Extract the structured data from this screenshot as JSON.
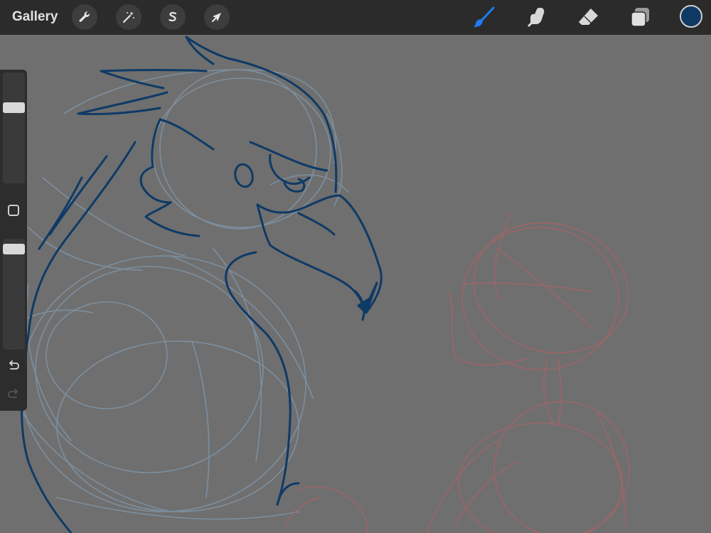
{
  "toolbar": {
    "gallery_label": "Gallery",
    "left_tools": [
      {
        "name": "actions",
        "icon": "wrench-icon"
      },
      {
        "name": "adjustments",
        "icon": "magic-wand-icon"
      },
      {
        "name": "selection",
        "icon": "selection-s-icon"
      },
      {
        "name": "transform",
        "icon": "arrow-cursor-icon"
      }
    ],
    "right_tools": [
      {
        "name": "brush",
        "icon": "brush-icon",
        "active": true
      },
      {
        "name": "smudge",
        "icon": "smudge-finger-icon",
        "active": false
      },
      {
        "name": "eraser",
        "icon": "eraser-icon",
        "active": false
      },
      {
        "name": "layers",
        "icon": "layers-icon",
        "active": false
      }
    ],
    "current_color": "#0f3a63",
    "active_tool_color": "#1e7cf2"
  },
  "sidebar": {
    "brush_size_level": 0.7,
    "opacity_level": 0.95,
    "undo_icon": "undo-arrow-icon",
    "redo_icon": "redo-arrow-icon",
    "modify_icon": "square-modify-icon"
  },
  "canvas": {
    "background": "#6f6f6f",
    "ink_color": "#0e3a66",
    "sketch_blue": "#7f95a8",
    "sketch_red": "#a36468"
  }
}
